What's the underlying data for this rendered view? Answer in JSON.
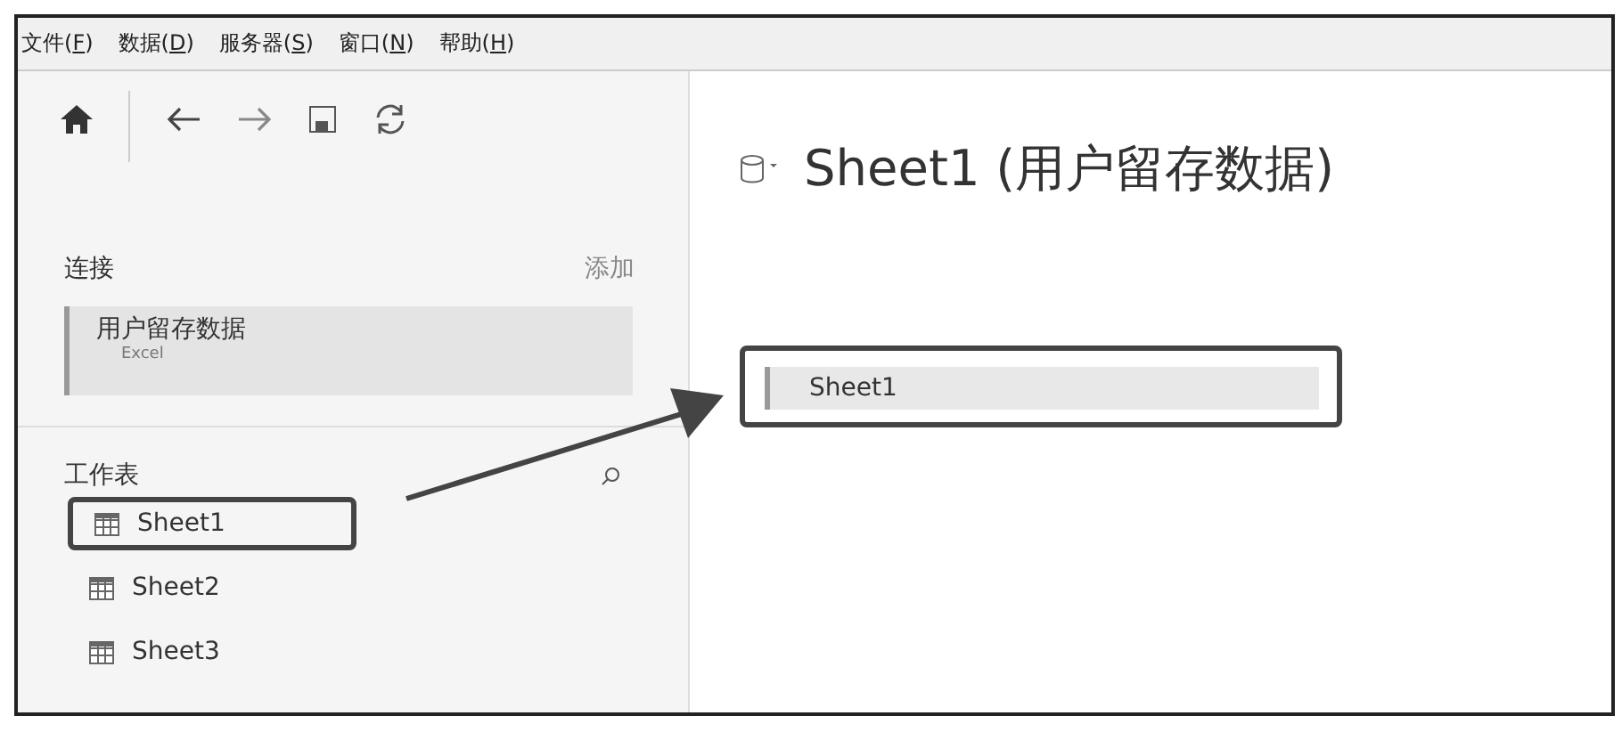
{
  "menu": [
    {
      "label": "文件(",
      "key": "F",
      "end": ")"
    },
    {
      "label": "数据(",
      "key": "D",
      "end": ")"
    },
    {
      "label": "服务器(",
      "key": "S",
      "end": ")"
    },
    {
      "label": "窗口(",
      "key": "N",
      "end": ")"
    },
    {
      "label": "帮助(",
      "key": "H",
      "end": ")"
    }
  ],
  "sidebar": {
    "connections": {
      "title": "连接",
      "action": "添加",
      "items": [
        {
          "name": "用户留存数据",
          "type": "Excel",
          "selected": true
        }
      ]
    },
    "sheets": {
      "title": "工作表",
      "items": [
        {
          "label": "Sheet1",
          "annotated": true
        },
        {
          "label": "Sheet2",
          "annotated": false
        },
        {
          "label": "Sheet3",
          "annotated": false
        }
      ]
    }
  },
  "canvas": {
    "title": "Sheet1 (用户留存数据)",
    "tables": [
      {
        "label": "Sheet1",
        "annotated": true
      }
    ]
  },
  "annotation_arrow": true
}
